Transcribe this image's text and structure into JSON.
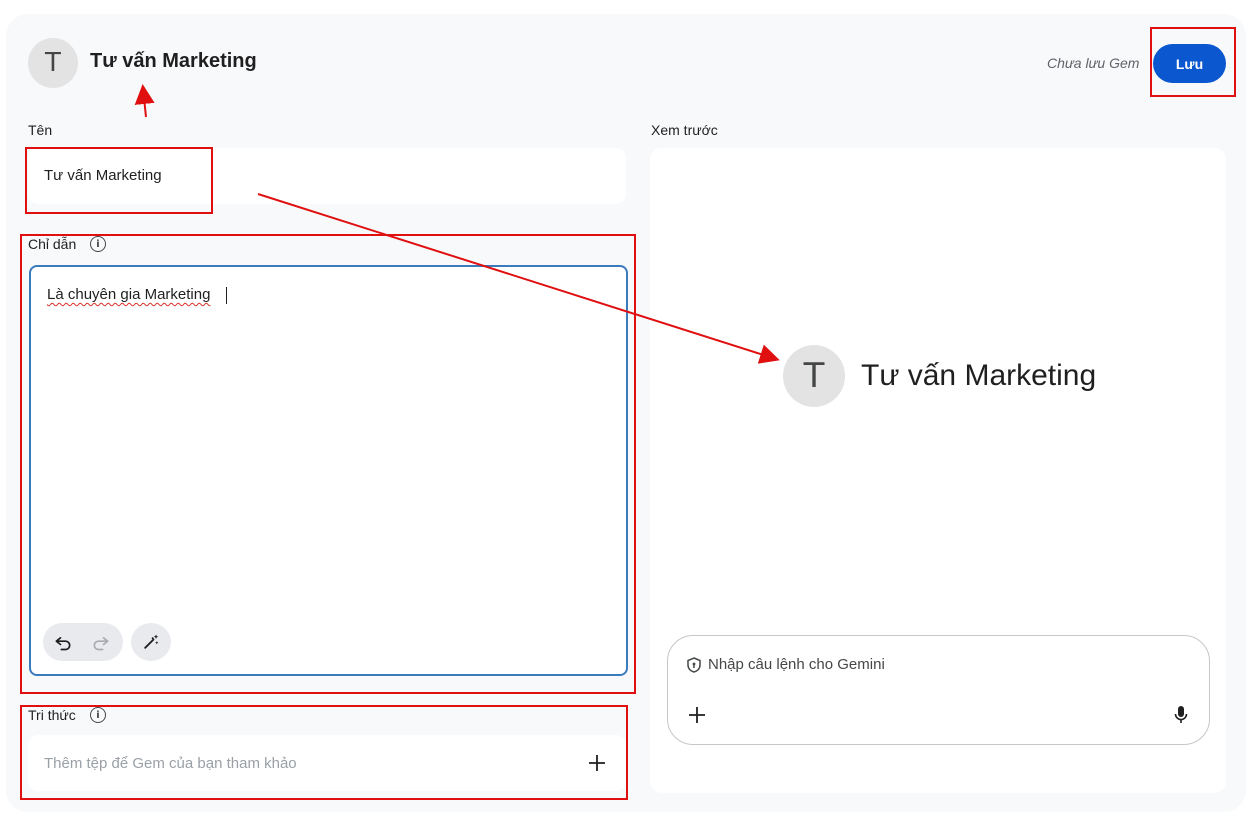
{
  "header": {
    "avatar_letter": "T",
    "title": "Tư vấn Marketing",
    "save_status": "Chưa lưu Gem",
    "save_label": "Lưu"
  },
  "form": {
    "name_label": "Tên",
    "name_value": "Tư vấn Marketing",
    "instructions_label": "Chỉ dẫn",
    "instructions_value": "Là chuyên gia Marketing",
    "knowledge_label": "Tri thức",
    "knowledge_placeholder": "Thêm tệp để Gem của bạn tham khảo"
  },
  "preview": {
    "label": "Xem trước",
    "avatar_letter": "T",
    "title": "Tư vấn Marketing",
    "prompt_placeholder": "Nhập câu lệnh cho Gemini"
  },
  "icons": {
    "info": "info-icon",
    "undo": "undo-icon",
    "redo": "redo-icon",
    "magic": "magic-wand-icon",
    "add": "plus-icon",
    "shield": "shield-icon",
    "mic": "mic-icon"
  },
  "colors": {
    "accent": "#0b57d0",
    "annotation": "#e01010"
  }
}
